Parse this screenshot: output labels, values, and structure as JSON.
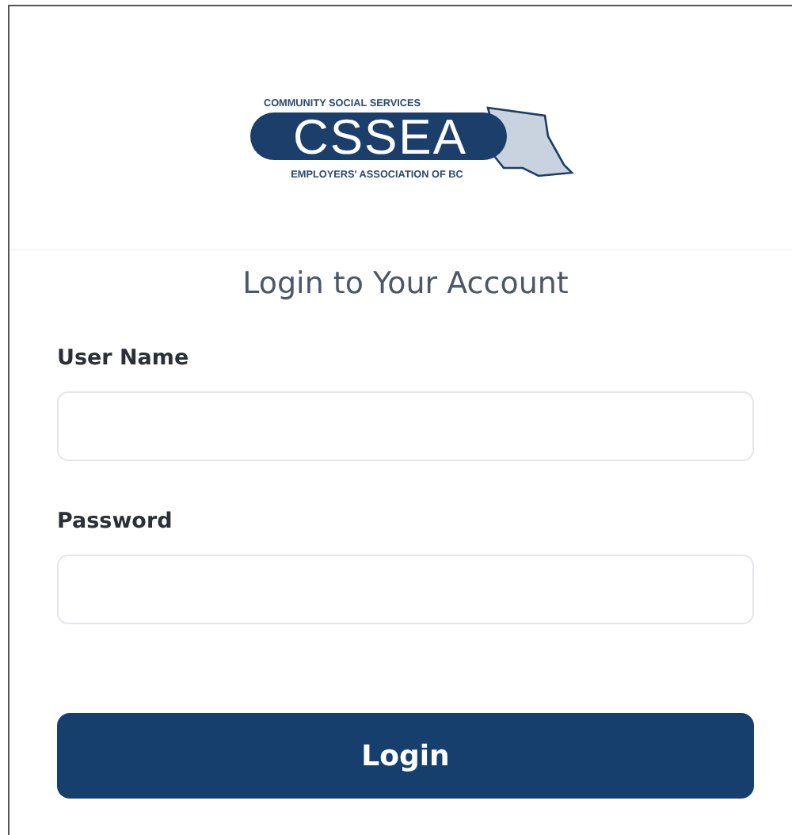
{
  "logo": {
    "top_line": "COMMUNITY SOCIAL SERVICES",
    "wordmark": "CSSEA",
    "bottom_line": "EMPLOYERS' ASSOCIATION OF BC"
  },
  "title": "Login to Your Account",
  "fields": [
    {
      "label": "User Name"
    },
    {
      "label": "Password"
    }
  ],
  "button": "Login"
}
